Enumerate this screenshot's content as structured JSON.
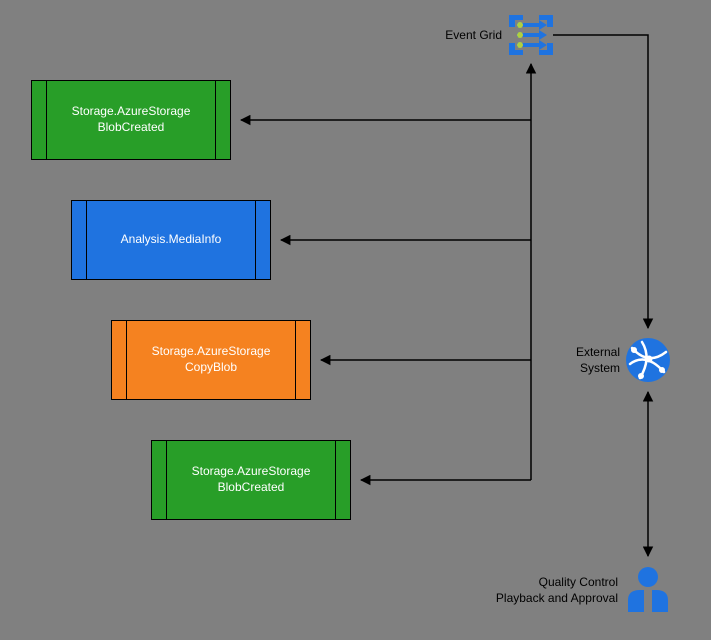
{
  "eventGrid": {
    "label": "Event Grid"
  },
  "externalSystem": {
    "label_line1": "External",
    "label_line2": "System"
  },
  "qc": {
    "label_line1": "Quality Control",
    "label_line2": "Playback and Approval"
  },
  "boxes": {
    "b1": {
      "line1": "Storage.AzureStorage",
      "line2": "BlobCreated"
    },
    "b2": {
      "line1": "Analysis.MediaInfo"
    },
    "b3": {
      "line1": "Storage.AzureStorage",
      "line2": "CopyBlob"
    },
    "b4": {
      "line1": "Storage.AzureStorage",
      "line2": "BlobCreated"
    }
  }
}
